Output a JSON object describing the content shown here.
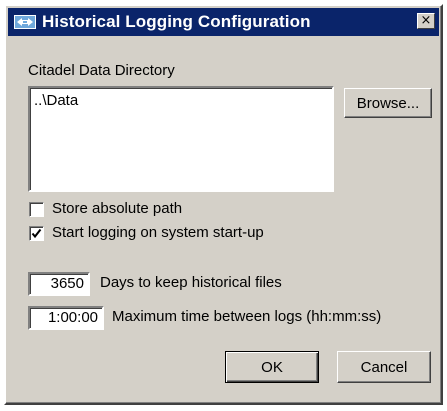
{
  "window": {
    "title": "Historical Logging Configuration",
    "close_glyph": "×",
    "icon": "network-icon",
    "titlebar_color": "#0a246a"
  },
  "directory": {
    "label": "Citadel Data Directory",
    "value": "..\\Data",
    "browse_label": "Browse..."
  },
  "options": {
    "store_absolute_path": {
      "label": "Store absolute path",
      "checked": false
    },
    "start_logging": {
      "label": "Start logging on system start-up",
      "checked": true
    }
  },
  "days": {
    "value": "3650",
    "label": "Days to keep historical files"
  },
  "max_time": {
    "value": "1:00:00",
    "label": "Maximum time between logs (hh:mm:ss)"
  },
  "buttons": {
    "ok": "OK",
    "cancel": "Cancel"
  }
}
